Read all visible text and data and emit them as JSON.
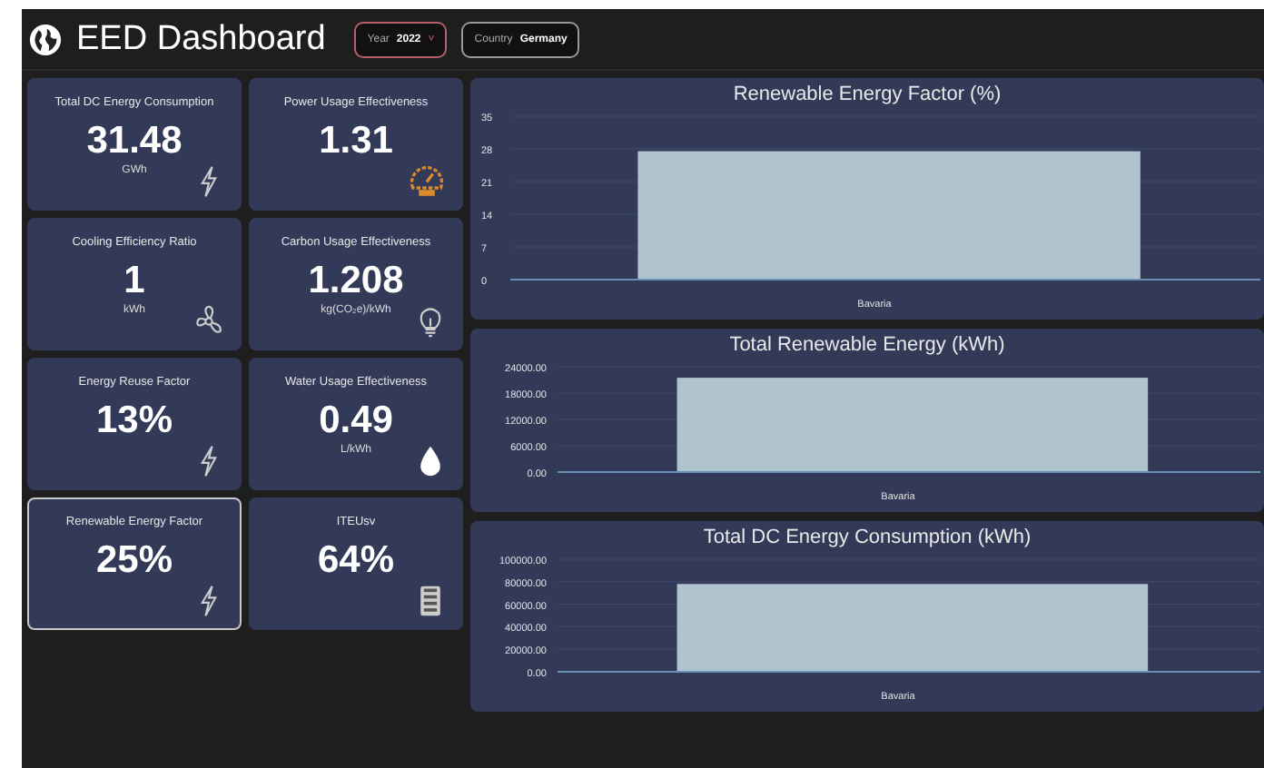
{
  "header": {
    "title": "EED Dashboard",
    "filters": [
      {
        "label": "Year",
        "value": "2022",
        "caret": "˅",
        "focused": true
      },
      {
        "label": "Country",
        "value": "Germany",
        "focused": false
      }
    ]
  },
  "cards": [
    {
      "title": "Total DC Energy Consumption",
      "value": "31.48",
      "unit": "GWh",
      "kind": "bolt",
      "selected": false
    },
    {
      "title": "Power Usage Effectiveness",
      "value": "1.31",
      "kind": "gauge",
      "selected": false
    },
    {
      "title": "Cooling Efficiency Ratio",
      "value": "1",
      "unit": "kWh",
      "kind": "fan",
      "selected": false
    },
    {
      "title": "Carbon Usage Effectiveness",
      "value": "1.208",
      "unit": "kg(CO₂e)/kWh",
      "kind": "bulb",
      "selected": false
    },
    {
      "title": "Energy Reuse Factor",
      "value": "13%",
      "kind": "bolt",
      "selected": false
    },
    {
      "title": "Water Usage Effectiveness",
      "value": "0.49",
      "unit": "L/kWh",
      "kind": "drop",
      "selected": false
    },
    {
      "title": "Renewable Energy Factor",
      "value": "25%",
      "kind": "bolt",
      "selected": true
    },
    {
      "title": "ITEUsv",
      "value": "64%",
      "kind": "server",
      "selected": false
    }
  ],
  "charts": [
    {
      "chart_data": {
        "type": "bar",
        "title": "Renewable Energy Factor (%)",
        "categories": [
          "Bavaria"
        ],
        "values": [
          27.5
        ],
        "ylim": [
          0,
          35
        ],
        "grid": true,
        "yticks": [
          0,
          7,
          14,
          21,
          28,
          35
        ]
      }
    },
    {
      "chart_data": {
        "type": "bar",
        "title": "Total Renewable Energy (kWh)",
        "categories": [
          "Bavaria"
        ],
        "values": [
          21500
        ],
        "ylim": [
          0,
          24000
        ],
        "grid": true,
        "yticks": [
          {
            "value": 0,
            "label": "0.00"
          },
          {
            "value": 6000,
            "label": "6000.00"
          },
          {
            "value": 12000,
            "label": "12000.00"
          },
          {
            "value": 18000,
            "label": "18000.00"
          },
          {
            "value": 24000,
            "label": "24000.00"
          }
        ]
      }
    },
    {
      "chart_data": {
        "type": "bar",
        "title": "Total DC Energy Consumption (kWh)",
        "categories": [
          "Bavaria"
        ],
        "values": [
          78000
        ],
        "ylim": [
          0,
          100000
        ],
        "grid": true,
        "yticks": [
          {
            "value": 0,
            "label": "0.00"
          },
          {
            "value": 20000,
            "label": "20000.00"
          },
          {
            "value": 40000,
            "label": "40000.00"
          },
          {
            "value": 60000,
            "label": "60000.00"
          },
          {
            "value": 80000,
            "label": "80000.00"
          },
          {
            "value": 100000,
            "label": "100000.00"
          }
        ]
      }
    }
  ]
}
